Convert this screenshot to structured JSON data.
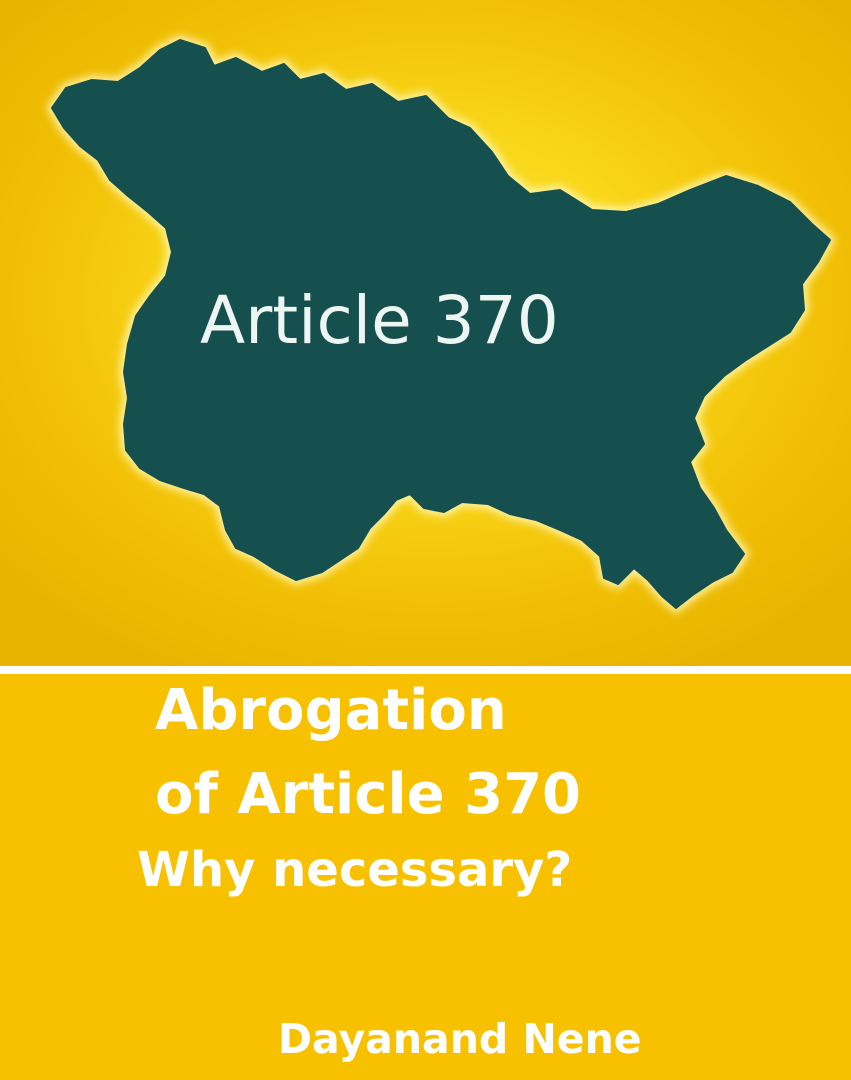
{
  "map": {
    "label": "Article 370",
    "fill_color": "#15504f",
    "outline_color": "#fff6b0",
    "background_colors": [
      "#fde33a",
      "#e9b400"
    ]
  },
  "title": {
    "line1": "Abrogation",
    "line2": "of Article 370",
    "line3": "Why necessary?"
  },
  "author": "Dayanand Nene",
  "colors": {
    "bottom_background": "#f8c100",
    "title_text": "#ffffff",
    "divider": "#ffffff"
  }
}
